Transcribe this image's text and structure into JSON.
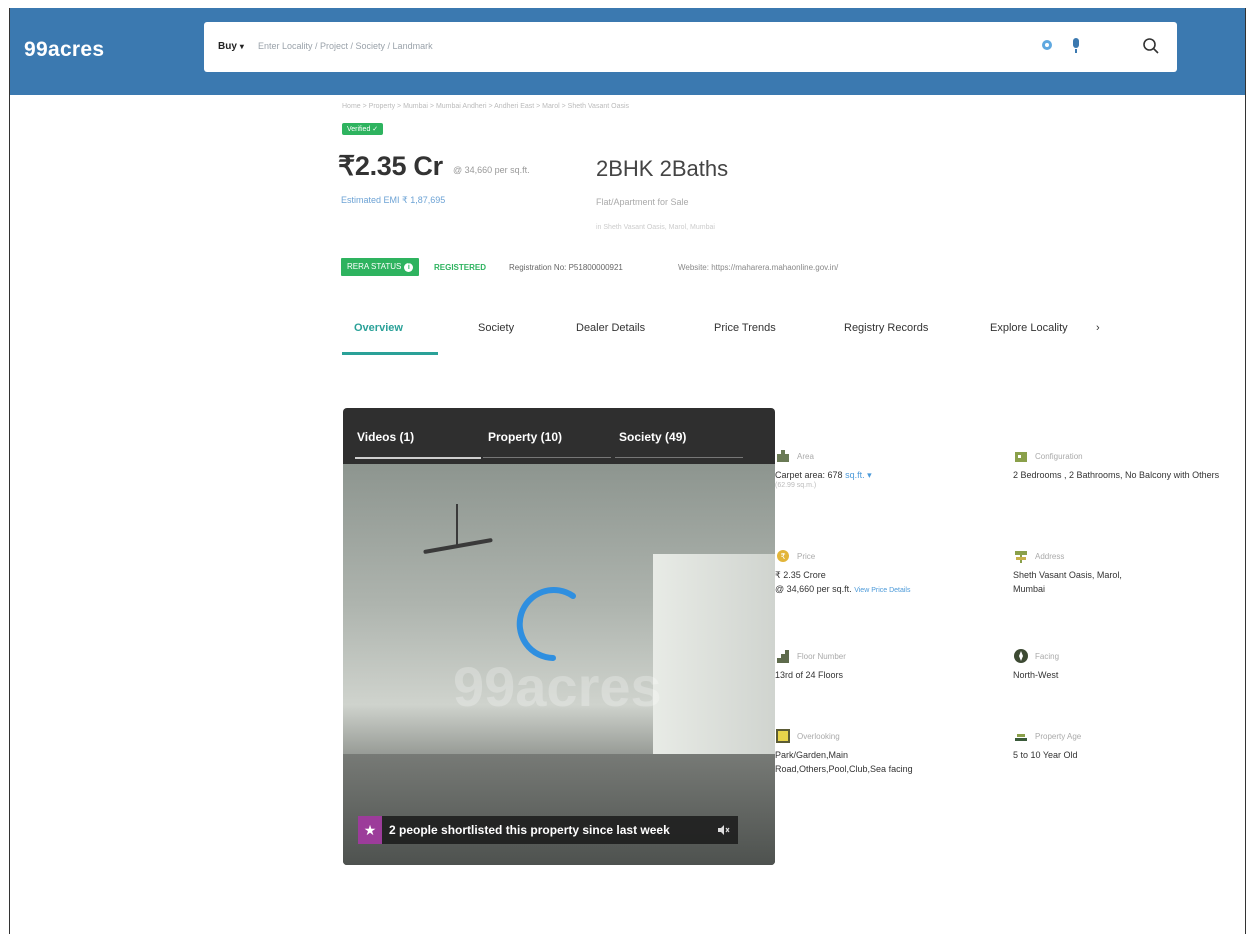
{
  "header": {
    "logo": "99acres",
    "search": {
      "buy_label": "Buy",
      "placeholder": "Enter Locality / Project / Society / Landmark"
    }
  },
  "breadcrumb": "Home > Property > Mumbai > Mumbai Andheri > Andheri East > Marol > Sheth Vasant Oasis",
  "listing": {
    "verified": "Verified",
    "price": "₹2.35 Cr",
    "price_rate": "@ 34,660 per sq.ft.",
    "emi": "Estimated EMI ₹ 1,87,695",
    "title": "2BHK 2Baths",
    "type": "Flat/Apartment for Sale",
    "address": "in Sheth Vasant Oasis, Marol, Mumbai"
  },
  "rera": {
    "badge": "RERA STATUS",
    "status": "REGISTERED",
    "registration": "Registration No: P51800000921",
    "website": "Website: https://maharera.mahaonline.gov.in/"
  },
  "tabs": [
    "Overview",
    "Society",
    "Dealer Details",
    "Price Trends",
    "Registry Records",
    "Explore Locality"
  ],
  "gallery": {
    "tabs": [
      "Videos (1)",
      "Property (10)",
      "Society (49)"
    ],
    "watermark": "99acres",
    "shortlist": "2 people shortlisted this property since last week"
  },
  "details": [
    {
      "icon": "area-icon",
      "label": "Area",
      "value": "Carpet area: 678",
      "unit": "sq.ft.",
      "sub": "(62.99 sq.m.)"
    },
    {
      "icon": "configuration-icon",
      "label": "Configuration",
      "value": "2 Bedrooms , 2 Bathrooms, No Balcony with Others"
    },
    {
      "icon": "price-icon",
      "label": "Price",
      "value": "₹ 2.35 Crore",
      "value2": "@ 34,660 per sq.ft.",
      "link": "View Price Details"
    },
    {
      "icon": "address-icon",
      "label": "Address",
      "value": "Sheth Vasant Oasis, Marol, Mumbai"
    },
    {
      "icon": "floor-number-icon",
      "label": "Floor Number",
      "value": "13rd of 24 Floors"
    },
    {
      "icon": "facing-icon",
      "label": "Facing",
      "value": "North-West"
    },
    {
      "icon": "overlooking-icon",
      "label": "Overlooking",
      "value": "Park/Garden,Main Road,Others,Pool,Club,Sea facing"
    },
    {
      "icon": "property-age-icon",
      "label": "Property Age",
      "value": "5 to 10 Year Old"
    }
  ]
}
